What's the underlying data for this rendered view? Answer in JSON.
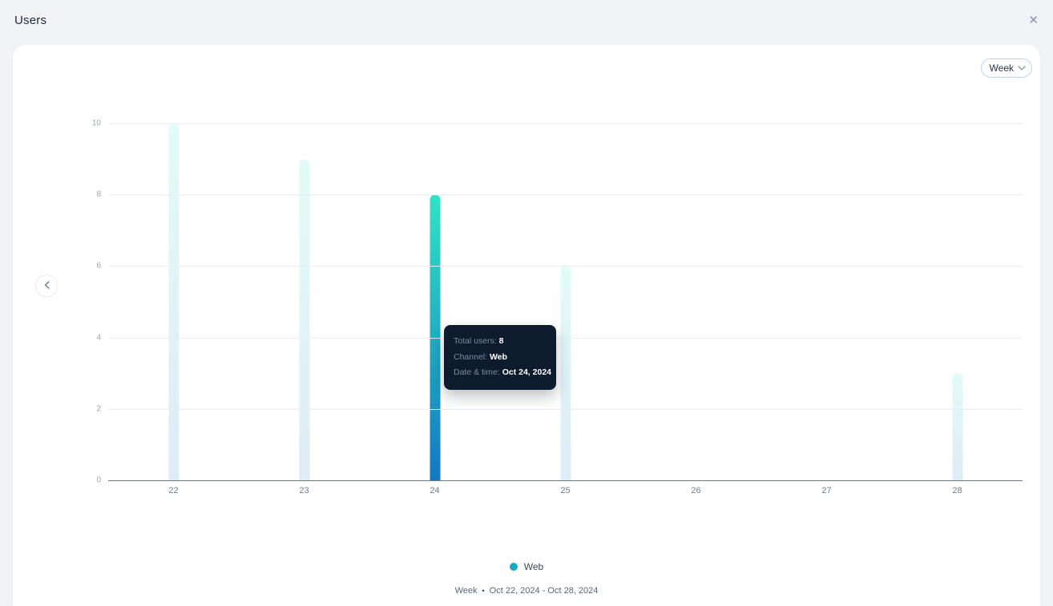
{
  "header": {
    "title": "Users",
    "close_icon": "✕"
  },
  "range_selector": {
    "value": "Week"
  },
  "tooltip": {
    "rows": [
      {
        "label": "Total users:",
        "value": "8"
      },
      {
        "label": "Channel:",
        "value": "Web"
      },
      {
        "label": "Date & time:",
        "value": "Oct 24, 2024"
      }
    ]
  },
  "legend": {
    "items": [
      {
        "label": "Web",
        "color": "#18a9c0"
      }
    ]
  },
  "footer": {
    "period": "Week",
    "separator": "•",
    "range": "Oct 22, 2024 - Oct 28, 2024"
  },
  "chart_data": {
    "type": "bar",
    "series_name": "Web",
    "categories": [
      "22",
      "23",
      "24",
      "25",
      "26",
      "27",
      "28"
    ],
    "values": [
      10,
      9,
      8,
      6,
      0,
      0,
      3
    ],
    "highlighted_index": 2,
    "highlighted_tooltip": {
      "total_users": 8,
      "channel": "Web",
      "date": "Oct 24, 2024"
    },
    "yticks": [
      0,
      2,
      4,
      6,
      8,
      10
    ],
    "ylim": [
      0,
      10
    ],
    "grid": true,
    "legend_position": "bottom",
    "colors": {
      "bar_gradient_top": "#31e3c3",
      "bar_gradient_bottom": "#1478c2",
      "faded_bar_opacity": 0.14,
      "legend_dot": "#18a9c0",
      "tooltip_bg": "#0d1b2d"
    }
  }
}
